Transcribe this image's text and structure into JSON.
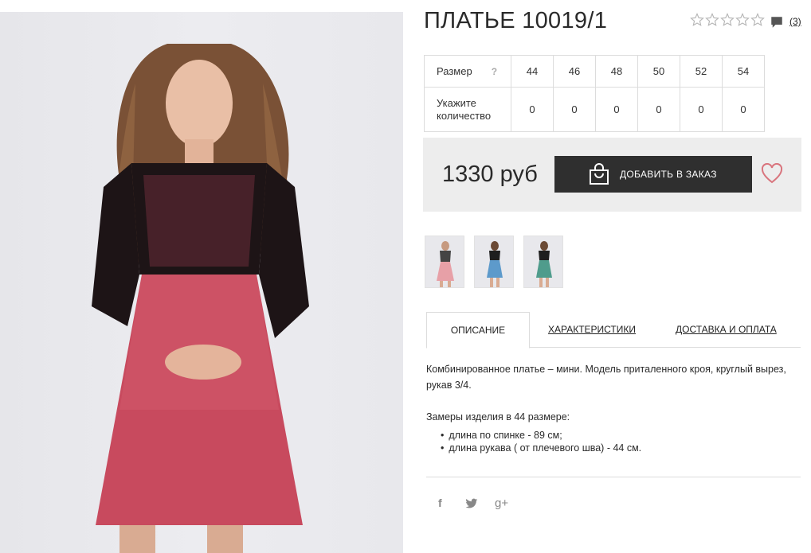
{
  "product": {
    "title": "ПЛАТЬЕ 10019/1",
    "rating_stars": 0,
    "rating_max": 5,
    "review_count": "(3)"
  },
  "sizes": {
    "size_label": "Размер",
    "help_glyph": "?",
    "qty_label": "Укажите количество",
    "columns": [
      "44",
      "46",
      "48",
      "50",
      "52",
      "54"
    ],
    "quantities": [
      "0",
      "0",
      "0",
      "0",
      "0",
      "0"
    ]
  },
  "purchase": {
    "price": "1330 руб",
    "add_button_label": "ДОБАВИТЬ В ЗАКАЗ"
  },
  "thumbnails": [
    {
      "dress_color": "#e7a0a7"
    },
    {
      "dress_color": "#5d9acb"
    },
    {
      "dress_color": "#4f9c8c"
    }
  ],
  "tabs": [
    {
      "label": "ОПИСАНИЕ"
    },
    {
      "label": "ХАРАКТЕРИСТИКИ"
    },
    {
      "label": "ДОСТАВКА И ОПЛАТА"
    }
  ],
  "description": {
    "text": "Комбинированное платье – мини. Модель приталенного кроя, круглый вырез, рукав 3/4.",
    "measure_title": "Замеры изделия в 44 размере:",
    "measures": [
      "длина по спинке - 89 см;",
      "длина рукава ( от плечевого шва) - 44 см."
    ]
  },
  "social": {
    "facebook": "f",
    "google_plus": "g+"
  },
  "colors": {
    "dark_button": "#2f2f2f",
    "heart": "#d9747d",
    "panel_bg": "#ededed",
    "border": "#dcdcdc"
  }
}
